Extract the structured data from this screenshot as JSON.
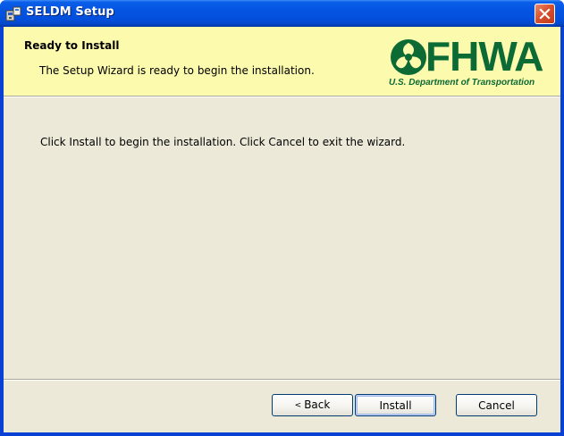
{
  "window": {
    "title": "SELDM Setup"
  },
  "banner": {
    "title": "Ready to Install",
    "description": "The Setup Wizard is ready to begin the installation.",
    "logo_text": "FHWA",
    "logo_subtext": "U.S. Department of Transportation"
  },
  "main": {
    "instructions": "Click Install to begin the installation.  Click Cancel to exit the wizard."
  },
  "buttons": {
    "back_arrow": "<",
    "back": "Back",
    "install": "Install",
    "cancel": "Cancel"
  },
  "icons": {
    "app": "setup-installer-icon",
    "close": "close-icon",
    "logo": "fhwa-logo-icon"
  },
  "colors": {
    "titlebar": "#0454e1",
    "banner_bg": "#fcfaad",
    "dialog_bg": "#ece9d8",
    "logo_green": "#0c6a35",
    "close_red": "#d8512e"
  }
}
